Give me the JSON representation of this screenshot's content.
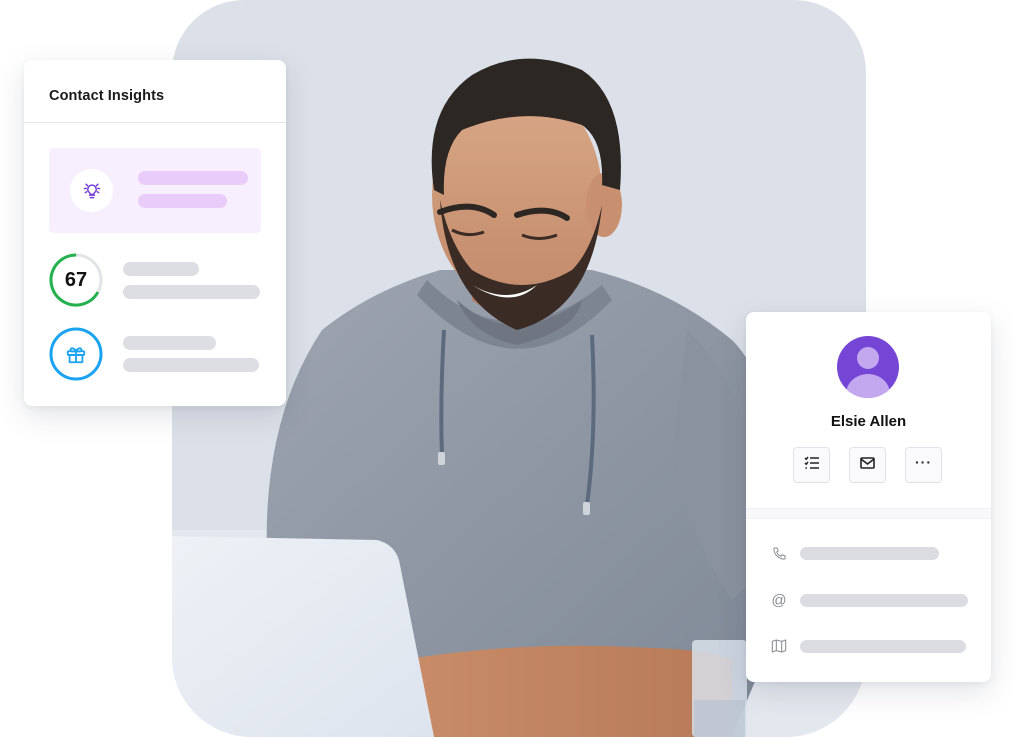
{
  "theme": {
    "accent_purple": "#7545d6",
    "avatar_light": "#c3a8ef",
    "tip_bg": "#f7effe",
    "tip_bar": "#e9ccfa",
    "score_green": "#22b14c",
    "gift_blue": "#1aa3f0",
    "skeleton": "#dcdee3",
    "hero_bg": "#dce0e8"
  },
  "hero": {
    "image": "man-smiling-at-laptop-photo",
    "icon": "photo"
  },
  "insights_card": {
    "title": "Contact Insights",
    "tip": {
      "icon": "lightbulb-icon"
    },
    "score": {
      "value": "67",
      "progress_fraction": 0.67,
      "icon": "score-ring"
    },
    "gift": {
      "icon": "gift-icon"
    }
  },
  "contact_card": {
    "name": "Elsie Allen",
    "avatar_icon": "user-avatar-icon",
    "actions": [
      {
        "id": "tasks",
        "icon": "task-list-icon"
      },
      {
        "id": "email",
        "icon": "envelope-icon"
      },
      {
        "id": "more",
        "icon": "more-icon",
        "label": "···"
      }
    ],
    "details": [
      {
        "id": "phone",
        "icon": "phone-icon"
      },
      {
        "id": "email",
        "icon": "at-sign-icon",
        "label": "@"
      },
      {
        "id": "address",
        "icon": "map-icon"
      }
    ]
  }
}
